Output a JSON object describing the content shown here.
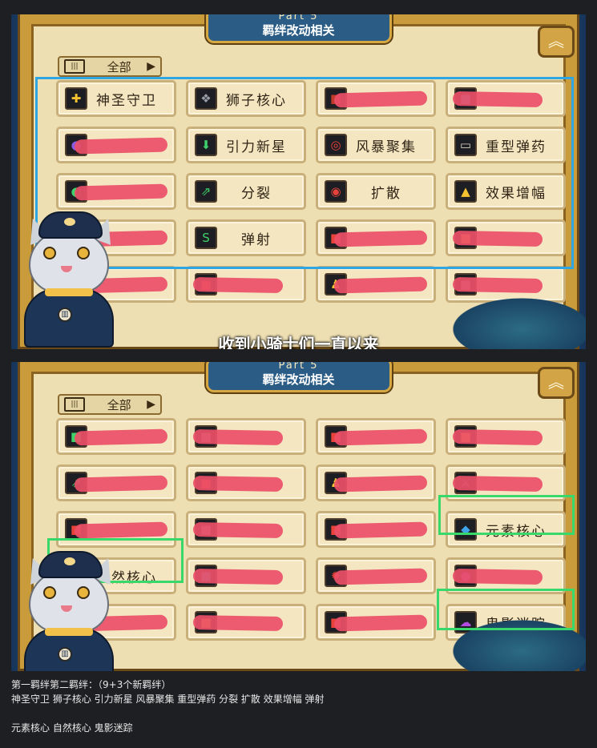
{
  "panel_1": {
    "part_label": "Part 5",
    "title": "羁绊改动相关",
    "filter": {
      "label": "全部",
      "arrow": "▶"
    },
    "cells": [
      {
        "label": "神圣守卫",
        "icon": "shield-icon",
        "icon_glyph": "✚",
        "icon_color": "#f2c230",
        "redacted": false
      },
      {
        "label": "狮子核心",
        "icon": "lion-icon",
        "icon_glyph": "❖",
        "icon_color": "#9a9ea8",
        "redacted": false
      },
      {
        "label": "",
        "icon": "unknown-icon",
        "icon_glyph": "■",
        "icon_color": "#c23a2a",
        "redacted": true
      },
      {
        "label": "",
        "icon": "unknown-icon",
        "icon_glyph": "■",
        "icon_color": "#39b4e6",
        "redacted": true
      },
      {
        "label": "",
        "icon": "unknown-icon",
        "icon_glyph": "●",
        "icon_color": "#8a5ae0",
        "redacted": true
      },
      {
        "label": "引力新星",
        "icon": "gravity-star-icon",
        "icon_glyph": "⬇",
        "icon_color": "#3fd26a",
        "redacted": false
      },
      {
        "label": "风暴聚集",
        "icon": "storm-icon",
        "icon_glyph": "◎",
        "icon_color": "#e8423a",
        "redacted": false
      },
      {
        "label": "重型弹药",
        "icon": "ammo-icon",
        "icon_glyph": "▭",
        "icon_color": "#d9d2c0",
        "redacted": false
      },
      {
        "label": "",
        "icon": "unknown-icon",
        "icon_glyph": "◐",
        "icon_color": "#3fd26a",
        "redacted": true
      },
      {
        "label": "分裂",
        "icon": "split-icon",
        "icon_glyph": "⇗",
        "icon_color": "#3fd26a",
        "redacted": false
      },
      {
        "label": "扩散",
        "icon": "spread-icon",
        "icon_glyph": "◉",
        "icon_color": "#e8423a",
        "redacted": false
      },
      {
        "label": "效果增幅",
        "icon": "effect-boost-icon",
        "icon_glyph": "▲",
        "icon_color": "#f2c230",
        "redacted": false
      },
      {
        "label": "",
        "icon": "unknown-icon",
        "icon_glyph": "■",
        "icon_color": "#9a9ea8",
        "redacted": true
      },
      {
        "label": "弹射",
        "icon": "bounce-icon",
        "icon_glyph": "S",
        "icon_color": "#3fd26a",
        "redacted": false
      },
      {
        "label": "",
        "icon": "unknown-icon",
        "icon_glyph": "■",
        "icon_color": "#e8423a",
        "redacted": true
      },
      {
        "label": "",
        "icon": "unknown-icon",
        "icon_glyph": "■",
        "icon_color": "#f2c230",
        "redacted": true
      },
      {
        "label": "",
        "icon": "unknown-icon",
        "icon_glyph": "■",
        "icon_color": "#e8423a",
        "redacted": true
      },
      {
        "label": "",
        "icon": "unknown-icon",
        "icon_glyph": "■",
        "icon_color": "#e8423a",
        "redacted": true
      },
      {
        "label": "",
        "icon": "unknown-icon",
        "icon_glyph": "♟",
        "icon_color": "#f2c230",
        "redacted": true
      },
      {
        "label": "",
        "icon": "unknown-icon",
        "icon_glyph": "■",
        "icon_color": "#9a9ea8",
        "redacted": true
      }
    ],
    "caption": "收到小骑士们一直以来"
  },
  "panel_2": {
    "part_label": "Part 5",
    "title": "羁绊改动相关",
    "filter": {
      "label": "全部",
      "arrow": "▶"
    },
    "cells": [
      {
        "label": "",
        "icon": "unknown-icon",
        "icon_glyph": "■",
        "icon_color": "#3fd26a",
        "redacted": true
      },
      {
        "label": "",
        "icon": "unknown-icon",
        "icon_glyph": "■",
        "icon_color": "#9a9ea8",
        "redacted": true
      },
      {
        "label": "",
        "icon": "unknown-icon",
        "icon_glyph": "■",
        "icon_color": "#e8423a",
        "redacted": true
      },
      {
        "label": "",
        "icon": "unknown-icon",
        "icon_glyph": "■",
        "icon_color": "#f2c230",
        "redacted": true
      },
      {
        "label": "",
        "icon": "unknown-icon",
        "icon_glyph": "⇗",
        "icon_color": "#3fd26a",
        "redacted": true
      },
      {
        "label": "",
        "icon": "unknown-icon",
        "icon_glyph": "■",
        "icon_color": "#e8423a",
        "redacted": true
      },
      {
        "label": "",
        "icon": "unknown-icon",
        "icon_glyph": "♟",
        "icon_color": "#f2c230",
        "redacted": true
      },
      {
        "label": "",
        "icon": "unknown-icon",
        "icon_glyph": "⚔",
        "icon_color": "#9a9ea8",
        "redacted": true
      },
      {
        "label": "",
        "icon": "unknown-icon",
        "icon_glyph": "■",
        "icon_color": "#e8423a",
        "redacted": true
      },
      {
        "label": "",
        "icon": "unknown-icon",
        "icon_glyph": "■",
        "icon_color": "#9a9ea8",
        "redacted": true
      },
      {
        "label": "",
        "icon": "unknown-icon",
        "icon_glyph": "■",
        "icon_color": "#e8423a",
        "redacted": true
      },
      {
        "label": "元素核心",
        "icon": "element-core-icon",
        "icon_glyph": "◆",
        "icon_color": "#3fa3e8",
        "redacted": false
      },
      {
        "label": "自然核心",
        "icon": "nature-core-icon",
        "icon_glyph": "✿",
        "icon_color": "#3fd26a",
        "redacted": false
      },
      {
        "label": "",
        "icon": "unknown-icon",
        "icon_glyph": "■",
        "icon_color": "#39b4e6",
        "redacted": true
      },
      {
        "label": "",
        "icon": "unknown-icon",
        "icon_glyph": "✹",
        "icon_color": "#e8423a",
        "redacted": true
      },
      {
        "label": "",
        "icon": "unknown-icon",
        "icon_glyph": "●",
        "icon_color": "#b04ae0",
        "redacted": true
      },
      {
        "label": "",
        "icon": "unknown-icon",
        "icon_glyph": "■",
        "icon_color": "#e8423a",
        "redacted": true
      },
      {
        "label": "",
        "icon": "unknown-icon",
        "icon_glyph": "■",
        "icon_color": "#f2c230",
        "redacted": true
      },
      {
        "label": "",
        "icon": "unknown-icon",
        "icon_glyph": "■",
        "icon_color": "#e8423a",
        "redacted": true
      },
      {
        "label": "鬼影迷踪",
        "icon": "ghost-icon",
        "icon_glyph": "☁",
        "icon_color": "#b04ae0",
        "redacted": false
      }
    ]
  },
  "footer": {
    "line_1": "第一羁绊第二羁绊：（9+3个新羁绊）",
    "line_2": "神圣守卫 狮子核心 引力新星 风暴聚集 重型弹药 分裂 扩散 效果增幅 弹射",
    "line_3": "元素核心 自然核心 鬼影迷踪"
  },
  "colors": {
    "highlight_blue": "#2ea6e4",
    "highlight_green": "#39d86a",
    "redaction": "#ec4f68"
  }
}
